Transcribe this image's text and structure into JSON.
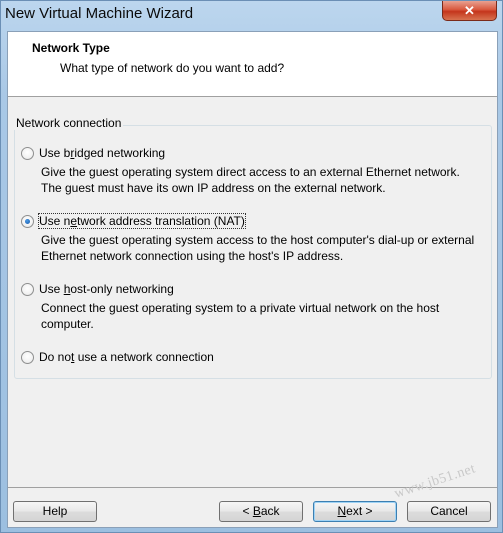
{
  "window": {
    "title": "New Virtual Machine Wizard",
    "close_glyph": "✕"
  },
  "header": {
    "title": "Network Type",
    "subtitle": "What type of network do you want to add?"
  },
  "group": {
    "legend": "Network connection"
  },
  "options": [
    {
      "pre": "Use b",
      "mnemonic": "r",
      "post": "idged networking",
      "checked": false,
      "description": "Give the guest operating system direct access to an external Ethernet network. The guest must have its own IP address on the external network."
    },
    {
      "pre": "Use n",
      "mnemonic": "e",
      "post": "twork address translation (NAT)",
      "checked": true,
      "description": "Give the guest operating system access to the host computer's dial-up or external Ethernet network connection using the host's IP address."
    },
    {
      "pre": "Use ",
      "mnemonic": "h",
      "post": "ost-only networking",
      "checked": false,
      "description": "Connect the guest operating system to a private virtual network on the host computer."
    },
    {
      "pre": "Do no",
      "mnemonic": "t",
      "post": " use a network connection",
      "checked": false,
      "description": ""
    }
  ],
  "buttons": {
    "help": "Help",
    "back": {
      "pre": "< ",
      "mnemonic": "B",
      "post": "ack"
    },
    "next": {
      "pre": "",
      "mnemonic": "N",
      "post": "ext >"
    },
    "cancel": "Cancel"
  },
  "watermark": "www.jb51.net"
}
